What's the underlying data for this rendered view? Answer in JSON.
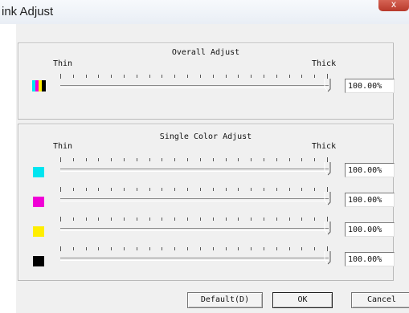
{
  "window": {
    "title": "ink Adjust",
    "close_glyph": "x"
  },
  "overall": {
    "title": "Overall Adjust",
    "thin": "Thin",
    "thick": "Thick",
    "value": "100.00%",
    "slider_level_percent": 100
  },
  "single": {
    "title": "Single Color Adjust",
    "thin": "Thin",
    "thick": "Thick",
    "rows": [
      {
        "color": "#00e5f0",
        "value": "100.00%",
        "slider_level_percent": 100
      },
      {
        "color": "#f000d6",
        "value": "100.00%",
        "slider_level_percent": 100
      },
      {
        "color": "#ffee00",
        "value": "100.00%",
        "slider_level_percent": 100
      },
      {
        "color": "#000000",
        "value": "100.00%",
        "slider_level_percent": 100
      }
    ]
  },
  "buttons": {
    "default": "Default(D)",
    "ok": "OK",
    "cancel": "Cancel"
  }
}
